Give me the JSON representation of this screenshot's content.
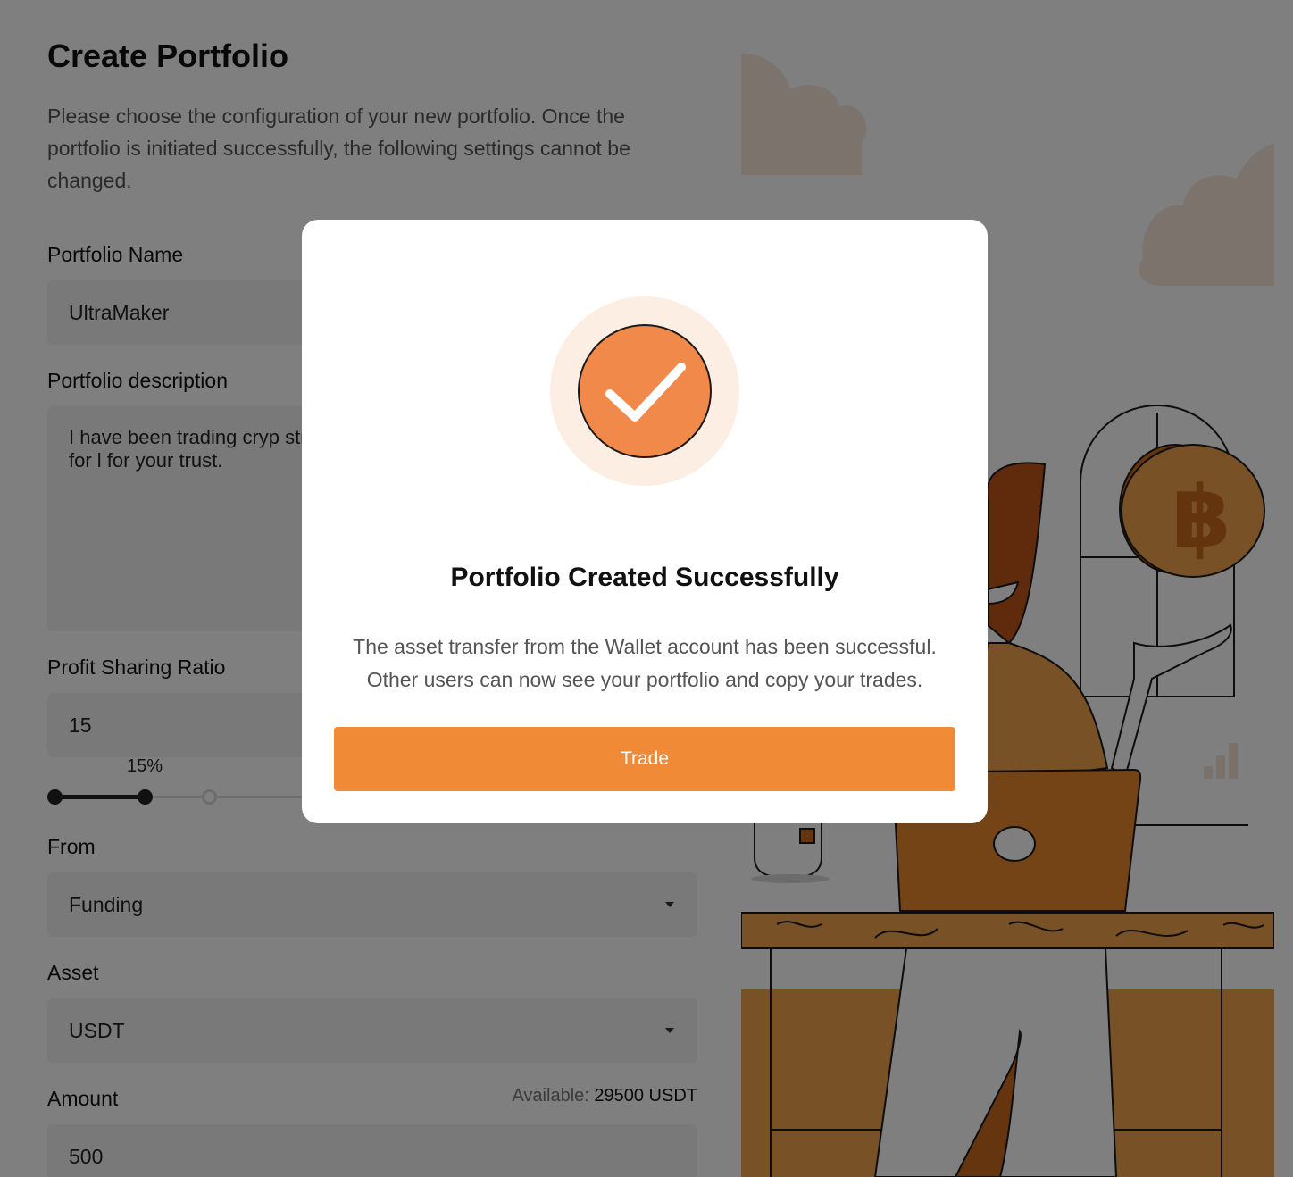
{
  "page": {
    "title": "Create Portfolio",
    "intro": "Please choose the configuration of your new portfolio. Once the portfolio is initiated successfully, the following settings cannot be changed."
  },
  "form": {
    "portfolio_name": {
      "label": "Portfolio Name",
      "value": "UltraMaker"
    },
    "portfolio_description": {
      "label": "Portfolio description",
      "value": "I have been trading cryp strategy is mainly focus currencies. Looking for l for your trust."
    },
    "profit_sharing": {
      "label": "Profit Sharing Ratio",
      "value": "15",
      "slider_label": "15%",
      "slider_level_percent": 15
    },
    "from": {
      "label": "From",
      "value": "Funding"
    },
    "asset": {
      "label": "Asset",
      "value": "USDT"
    },
    "amount": {
      "label": "Amount",
      "value": "500",
      "available_label": "Available:",
      "available_value": "29500 USDT"
    }
  },
  "modal": {
    "icon": "checkmark-icon",
    "title": "Portfolio Created Successfully",
    "body": "The asset transfer from the Wallet account has been successful. Other users can now see your portfolio and copy your trades.",
    "button_label": "Trade"
  },
  "colors": {
    "accent": "#f18a36",
    "success_circle": "#f0894a",
    "success_ring": "#fdeee4",
    "overlay": "rgba(0,0,0,0.5)"
  }
}
